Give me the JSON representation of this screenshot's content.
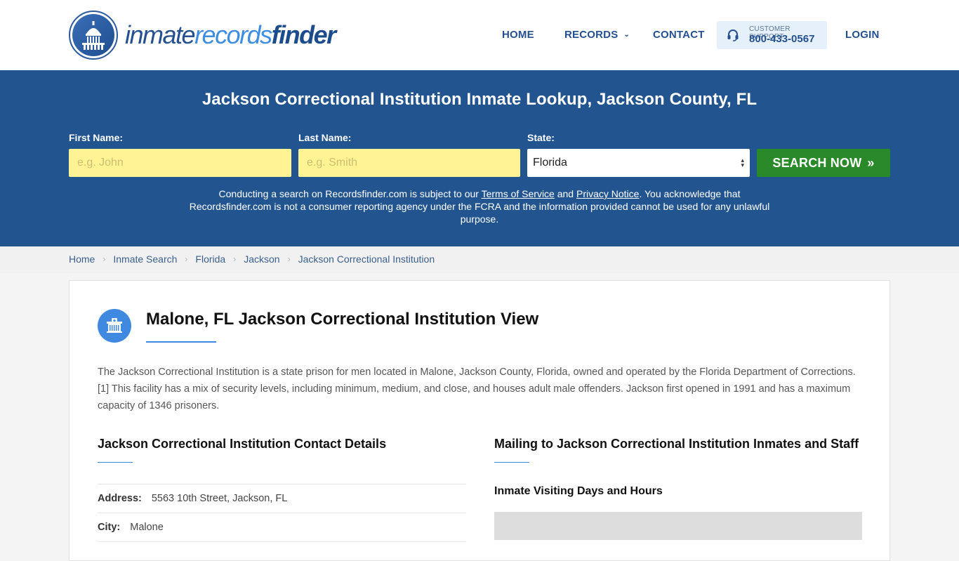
{
  "header": {
    "logo": {
      "part1": "inmate",
      "part2": "records",
      "part3": "finder"
    },
    "nav": {
      "home": "HOME",
      "records": "RECORDS",
      "contact": "CONTACT",
      "support_label": "CUSTOMER SUPPORT",
      "support_phone": "800-433-0567",
      "login": "LOGIN"
    }
  },
  "banner": {
    "title": "Jackson Correctional Institution Inmate Lookup, Jackson County, FL",
    "first_name_label": "First Name:",
    "first_name_placeholder": "e.g. John",
    "first_name_value": "",
    "last_name_label": "Last Name:",
    "last_name_placeholder": "e.g. Smith",
    "last_name_value": "",
    "state_label": "State:",
    "state_value": "Florida",
    "search_button": "SEARCH NOW",
    "disclaimer": {
      "pre": "Conducting a search on Recordsfinder.com is subject to our ",
      "tos": "Terms of Service",
      "and": " and ",
      "privacy": "Privacy Notice",
      "post": ". You acknowledge that Recordsfinder.com is not a consumer reporting agency under the FCRA and the information provided cannot be used for any unlawful purpose."
    }
  },
  "breadcrumb": [
    "Home",
    "Inmate Search",
    "Florida",
    "Jackson",
    "Jackson Correctional Institution"
  ],
  "main": {
    "title": "Malone, FL Jackson Correctional Institution View",
    "intro": "The Jackson Correctional Institution is a state prison for men located in Malone, Jackson County, Florida, owned and operated by the Florida Department of Corrections.[1] This facility has a mix of security levels, including minimum, medium, and close, and houses adult male offenders. Jackson first opened in 1991 and has a maximum capacity of 1346 prisoners.",
    "contact": {
      "title": "Jackson Correctional Institution Contact Details",
      "rows": [
        {
          "label": "Address:",
          "value": "5563 10th Street, Jackson, FL"
        },
        {
          "label": "City:",
          "value": "Malone"
        }
      ]
    },
    "mailing": {
      "title": "Mailing to Jackson Correctional Institution Inmates and Staff",
      "visiting_title": "Inmate Visiting Days and Hours"
    }
  },
  "colors": {
    "brand_blue": "#22548f",
    "accent_blue": "#3f8ae0",
    "search_green": "#2a8a2a",
    "input_yellow": "#fff394"
  }
}
